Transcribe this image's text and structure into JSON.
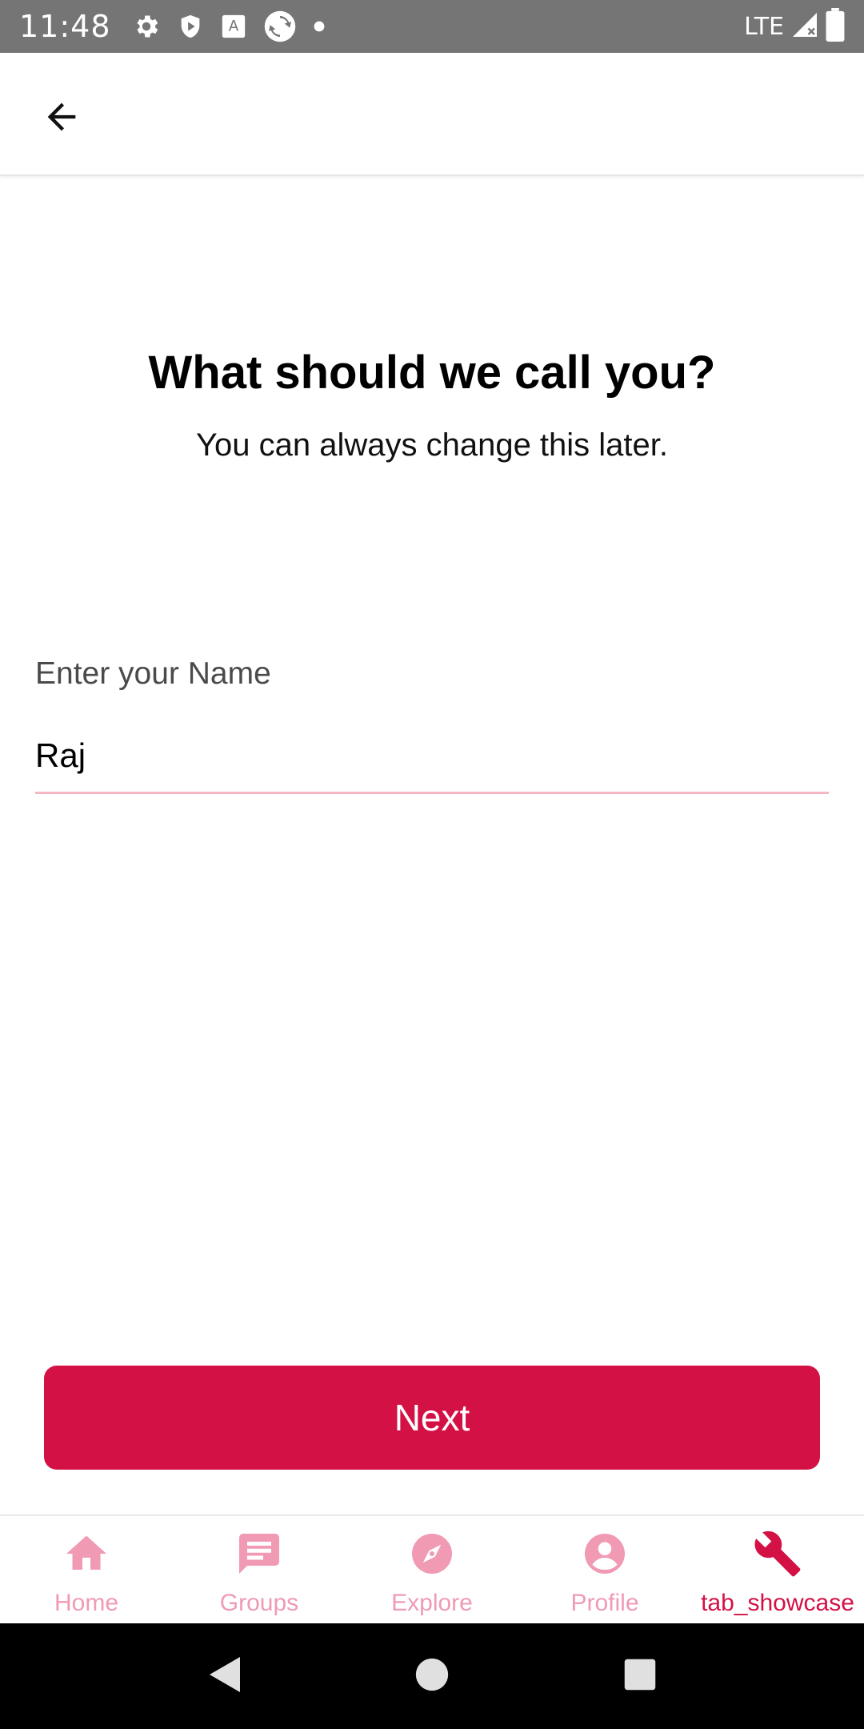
{
  "status_bar": {
    "time": "11:48",
    "network": "LTE",
    "icons": [
      "gear-icon",
      "shield-play-icon",
      "keyboard-a-icon",
      "sync-icon",
      "dot-icon",
      "signal-icon",
      "battery-icon"
    ]
  },
  "app_bar": {
    "back_icon": "arrow-back-icon"
  },
  "content": {
    "title": "What should we call you?",
    "subtitle": "You can always change this later.",
    "name_field": {
      "label": "Enter your Name",
      "value": "Raj"
    },
    "next_label": "Next"
  },
  "bottom_nav": {
    "items": [
      {
        "label": "Home",
        "icon": "home-icon",
        "active": false
      },
      {
        "label": "Groups",
        "icon": "chat-icon",
        "active": false
      },
      {
        "label": "Explore",
        "icon": "compass-icon",
        "active": false
      },
      {
        "label": "Profile",
        "icon": "account-icon",
        "active": false
      },
      {
        "label": "tab_showcase",
        "icon": "wrench-icon",
        "active": true
      }
    ]
  },
  "colors": {
    "accent": "#d31145",
    "inactive": "#f09ab4",
    "underline": "#f5b8c3",
    "status_bar": "#757575"
  },
  "system_nav": {
    "icons": [
      "back-triangle-icon",
      "home-circle-icon",
      "recents-square-icon"
    ]
  }
}
